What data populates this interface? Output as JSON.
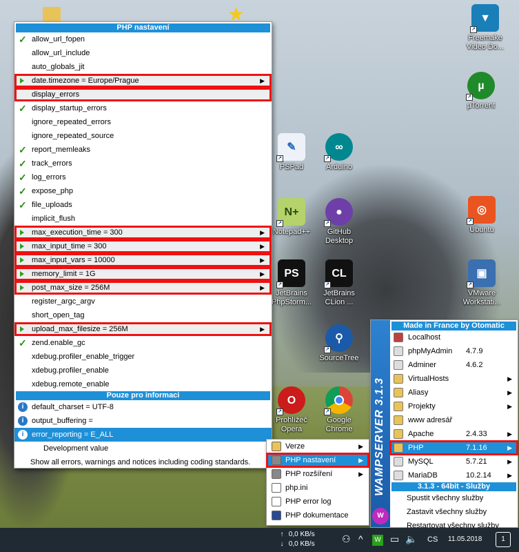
{
  "menu": {
    "header": "PHP nastavení",
    "items": [
      {
        "label": "allow_url_fopen",
        "state": "check"
      },
      {
        "label": "allow_url_include",
        "state": "none"
      },
      {
        "label": "auto_globals_jit",
        "state": "none"
      },
      {
        "label": "date.timezone = Europe/Prague",
        "state": "sub"
      },
      {
        "label": "display_errors",
        "state": "none"
      },
      {
        "label": "display_startup_errors",
        "state": "check"
      },
      {
        "label": "ignore_repeated_errors",
        "state": "none"
      },
      {
        "label": "ignore_repeated_source",
        "state": "none"
      },
      {
        "label": "report_memleaks",
        "state": "check"
      },
      {
        "label": "track_errors",
        "state": "check"
      },
      {
        "label": "log_errors",
        "state": "check"
      },
      {
        "label": "expose_php",
        "state": "check"
      },
      {
        "label": "file_uploads",
        "state": "check"
      },
      {
        "label": "implicit_flush",
        "state": "none"
      },
      {
        "label": "max_execution_time = 300",
        "state": "sub"
      },
      {
        "label": "max_input_time = 300",
        "state": "sub"
      },
      {
        "label": "max_input_vars = 10000",
        "state": "sub"
      },
      {
        "label": "memory_limit = 1G",
        "state": "sub"
      },
      {
        "label": "post_max_size = 256M",
        "state": "sub"
      },
      {
        "label": "register_argc_argv",
        "state": "none"
      },
      {
        "label": "short_open_tag",
        "state": "none"
      },
      {
        "label": "upload_max_filesize = 256M",
        "state": "sub"
      },
      {
        "label": "zend.enable_gc",
        "state": "check"
      },
      {
        "label": "xdebug.profiler_enable_trigger",
        "state": "none"
      },
      {
        "label": "xdebug.profiler_enable",
        "state": "none"
      },
      {
        "label": "xdebug.remote_enable",
        "state": "none"
      }
    ],
    "info_header": "Pouze pro informaci",
    "info_items": [
      {
        "label": "default_charset = UTF-8"
      },
      {
        "label": "output_buffering ="
      },
      {
        "label": "error_reporting = E_ALL"
      }
    ],
    "dev_value": "Development value",
    "description": "Show all errors, warnings and notices including coding standards."
  },
  "submenu": {
    "items": [
      {
        "label": "Verze",
        "has_sub": true
      },
      {
        "label": "PHP nastavení",
        "has_sub": true
      },
      {
        "label": "PHP rozšíření",
        "has_sub": true
      },
      {
        "label": "php.ini",
        "has_sub": false
      },
      {
        "label": "PHP error log",
        "has_sub": false
      },
      {
        "label": "PHP dokumentace",
        "has_sub": false
      }
    ]
  },
  "wamp": {
    "side_title": "WAMPSERVER 3.1.3",
    "header": "Made in France by Otomatic",
    "items": [
      {
        "label": "Localhost",
        "ver": "",
        "sub": false
      },
      {
        "label": "phpMyAdmin",
        "ver": "4.7.9",
        "sub": false
      },
      {
        "label": "Adminer",
        "ver": "4.6.2",
        "sub": false
      },
      {
        "label": "VirtualHosts",
        "ver": "",
        "sub": true
      },
      {
        "label": "Aliasy",
        "ver": "",
        "sub": true
      },
      {
        "label": "Projekty",
        "ver": "",
        "sub": true
      },
      {
        "label": "www adresář",
        "ver": "",
        "sub": false
      },
      {
        "label": "Apache",
        "ver": "2.4.33",
        "sub": true
      },
      {
        "label": "PHP",
        "ver": "7.1.16",
        "sub": true
      },
      {
        "label": "MySQL",
        "ver": "5.7.21",
        "sub": true
      },
      {
        "label": "MariaDB",
        "ver": "10.2.14",
        "sub": true
      }
    ],
    "services_header": "3.1.3 - 64bit - Služby",
    "services": [
      {
        "label": "Spustit všechny služby"
      },
      {
        "label": "Zastavit všechny služby"
      },
      {
        "label": "Restartovat všechny služby"
      }
    ]
  },
  "desktop_icons": [
    {
      "label": "Freemake Video Do...",
      "icon": "freemake-icon",
      "color": "#1a7fb8"
    },
    {
      "label": "µTorrent",
      "icon": "utorrent-icon",
      "color": "#1f8a2a"
    },
    {
      "label": "PSPad",
      "icon": "pspad-icon",
      "color": "#2a6ab8"
    },
    {
      "label": "Arduino",
      "icon": "arduino-icon",
      "color": "#00878f"
    },
    {
      "label": "Notepad++",
      "icon": "notepadpp-icon",
      "color": "#7aa532"
    },
    {
      "label": "GitHub Desktop",
      "icon": "github-icon",
      "color": "#6e3fa8"
    },
    {
      "label": "Ubuntu",
      "icon": "ubuntu-icon",
      "color": "#e95420"
    },
    {
      "label": "JetBrains PhpStorm...",
      "icon": "phpstorm-icon",
      "color": "#111111"
    },
    {
      "label": "JetBrains CLion ...",
      "icon": "clion-icon",
      "color": "#111111"
    },
    {
      "label": "VMware Workstati...",
      "icon": "vmware-icon",
      "color": "#3a6fb0"
    },
    {
      "label": "SourceTree",
      "icon": "sourcetree-icon",
      "color": "#1a5aa8"
    },
    {
      "label": "Prohlížeč Opera",
      "icon": "opera-icon",
      "color": "#cc1b1b"
    },
    {
      "label": "Google Chrome",
      "icon": "chrome-icon",
      "color": "#3a9a3a"
    }
  ],
  "taskbar": {
    "upload": "0,0 KB/s",
    "download": "0,0 KB/s",
    "lang": "CS",
    "date": "11.05.2018",
    "notifications": "1"
  }
}
